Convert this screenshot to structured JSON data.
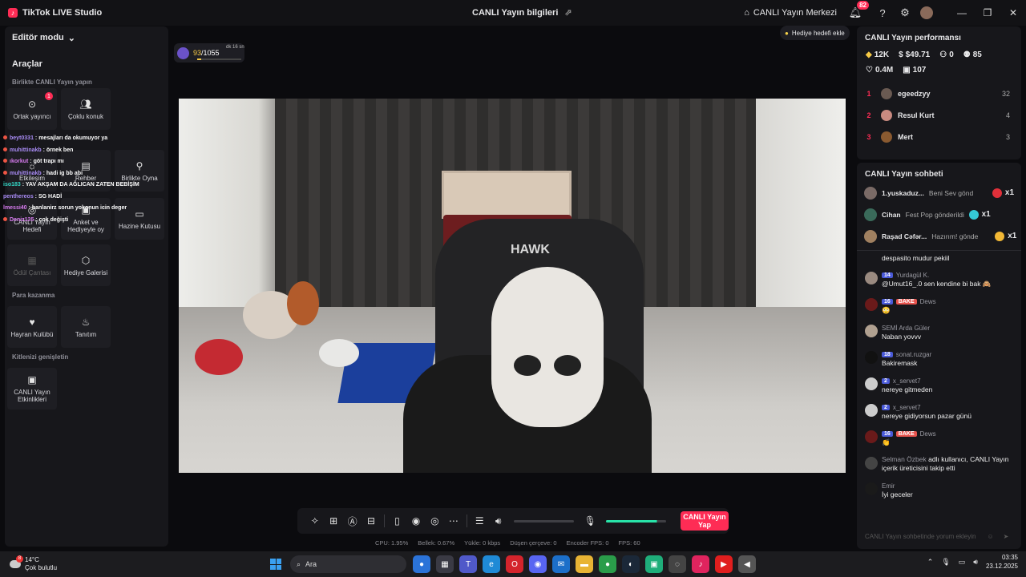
{
  "app": {
    "name": "TikTok LIVE Studio"
  },
  "header": {
    "title": "CANLI Yayın bilgileri",
    "center_button": "CANLI Yayın Merkezi",
    "notification_count": "82"
  },
  "left": {
    "mode": "Editör modu",
    "tools_title": "Araçlar",
    "together_label": "Birlikte CANLI Yayın yapın",
    "tools": [
      {
        "label": "Ortak yayıncı",
        "badge": "1"
      },
      {
        "label": "Çoklu konuk"
      },
      {
        "label": "Etkileşim"
      },
      {
        "label": "Rehber"
      },
      {
        "label": "Birlikte Oyna"
      },
      {
        "label": "CANLI Yayın Hedefi"
      },
      {
        "label": "Anket ve Hediyeyle oy"
      },
      {
        "label": "Hazine Kutusu"
      },
      {
        "label": "Ödül Çantası"
      },
      {
        "label": "Hediye Galerisi"
      }
    ],
    "monetize_label": "Para kazanma",
    "monetize_tools": [
      {
        "label": "Hayran Kulübü"
      },
      {
        "label": "Tanıtım"
      }
    ],
    "extend_label": "Kitlenizi genişletin",
    "extend_tools": [
      {
        "label": "CANLI Yayın Etkinlikleri"
      }
    ]
  },
  "chat_overlay": [
    {
      "user": "beyt0331",
      "msg": "mesajları da okumuyor ya"
    },
    {
      "user": "muhittinakb",
      "msg": "örnek ben"
    },
    {
      "user": "ıkorkut",
      "msg": "göt trapı mı"
    },
    {
      "user": "muhittinakb",
      "msg": "hadi ig bb abi"
    },
    {
      "user": "iso183",
      "msg": "YAV AKŞAM DA AĞLICAN ZATEN BEBİŞİM"
    },
    {
      "user": "penthereos",
      "msg": "SG HADİ"
    },
    {
      "user": "lmessi40",
      "msg": "banlanirz sorun yokonun icin deger"
    },
    {
      "user": "Deniz135",
      "msg": "çok değişti"
    }
  ],
  "goal": {
    "current": "93",
    "total": "/1055",
    "note": "dk 16 sn",
    "progress": 0.088
  },
  "gift_goal_button": "Hediye hedefi ekle",
  "video": {
    "hawk_text": "HAWK"
  },
  "toolbar": {
    "go_live": "CANLI Yayın Yap",
    "mic_level": 0.85
  },
  "stats": {
    "cpu": "CPU: 1.95%",
    "memory": "Bellek: 0.67%",
    "upload": "Yükle: 0 kbps",
    "dropped": "Düşen çerçeve: 0",
    "encoder": "Encoder FPS: 0",
    "fps": "FPS: 60"
  },
  "performance": {
    "title": "CANLI Yayın performansı",
    "diamonds": "12K",
    "earnings": "$49.71",
    "viewers": "0",
    "followers": "85",
    "likes": "0.4M",
    "gifts": "107",
    "ranking": [
      {
        "rank": "1",
        "name": "egeedzyy",
        "score": "32"
      },
      {
        "rank": "2",
        "name": "Resul Kurt",
        "score": "4"
      },
      {
        "rank": "3",
        "name": "Mert",
        "score": "3"
      }
    ]
  },
  "chat": {
    "title": "CANLI Yayın sohbeti",
    "gifts": [
      {
        "user": "1.yuskaduz...",
        "msg": "Beni Sev gönd",
        "count": "x1",
        "color": "#e0303a"
      },
      {
        "user": "Cihan",
        "msg": "Fest Pop gönderildi",
        "count": "x1",
        "color": "#35c9d6"
      },
      {
        "user": "Raşad Cəfər...",
        "msg": "Hazırım! gönde",
        "count": "x1",
        "color": "#f2b835"
      }
    ],
    "messages": [
      {
        "user": "",
        "text": "despasito mudur pekiil"
      },
      {
        "user": "Yurdagül K.",
        "level": "14",
        "text": "@Umut16_.0 sen kendine bi bak 🙈"
      },
      {
        "user": "Dews",
        "level": "16",
        "fan": "BAKE",
        "text": "😳"
      },
      {
        "user": "SEMİ Arda Güler",
        "text": "Naban yovvv"
      },
      {
        "user": "sonat.ruzgar",
        "level": "18",
        "text": "Bakiremask"
      },
      {
        "user": "x_servet7",
        "level": "2",
        "text": "nereye gitmeden"
      },
      {
        "user": "x_servet7",
        "level": "2",
        "text": "nereye gidiyorsun pazar günü"
      },
      {
        "user": "Dews",
        "level": "16",
        "fan": "BAKE",
        "text": "👏"
      },
      {
        "user": "Selman Özbek",
        "text": "adlı kullanıcı, CANLI Yayın içerik üreticisini takip etti"
      },
      {
        "user": "Emir",
        "text": "İyi geceler"
      }
    ],
    "input_placeholder": "CANLI Yayın sohbetinde yorum ekleyin"
  },
  "taskbar": {
    "temp": "14°C",
    "weather": "Çok bulutlu",
    "weather_badge": "8",
    "search": "Ara",
    "time": "03:35",
    "date": "23.12.2025"
  }
}
